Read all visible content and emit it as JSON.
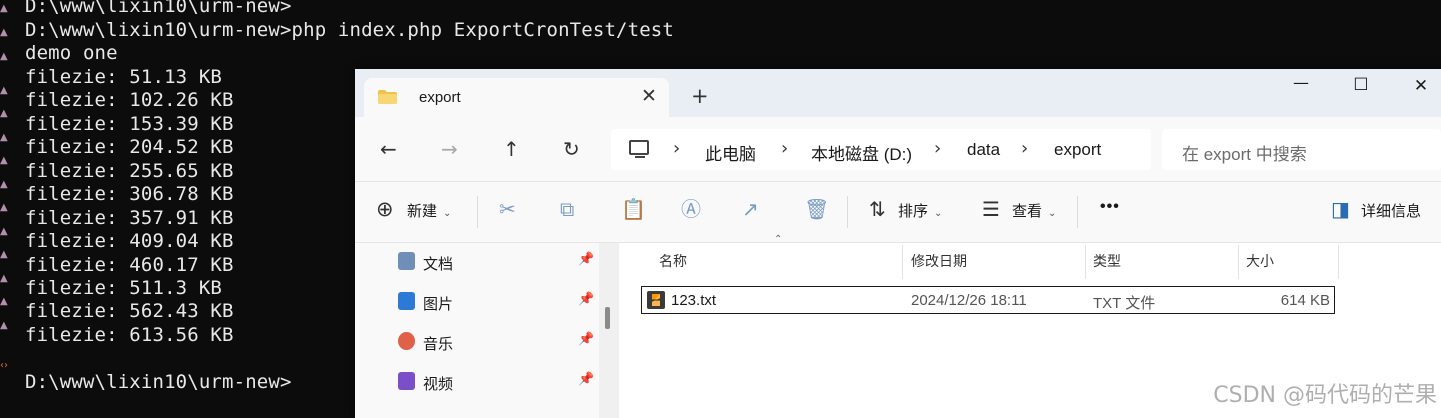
{
  "terminal": {
    "lines": [
      "D:\\www\\lixin10\\urm-new>",
      "D:\\www\\lixin10\\urm-new>php index.php ExportCronTest/test",
      "demo one",
      "filezie: 51.13 KB",
      "filezie: 102.26 KB",
      "filezie: 153.39 KB",
      "filezie: 204.52 KB",
      "filezie: 255.65 KB",
      "filezie: 306.78 KB",
      "filezie: 357.91 KB",
      "filezie: 409.04 KB",
      "filezie: 460.17 KB",
      "filezie: 511.3 KB",
      "filezie: 562.43 KB",
      "filezie: 613.56 KB",
      "",
      "D:\\www\\lixin10\\urm-new>"
    ]
  },
  "explorer": {
    "tab": {
      "label": "export",
      "icon": "folder-icon"
    },
    "window_controls": {
      "minimize": "—",
      "maximize": "☐",
      "close": "✕"
    },
    "nav": {
      "back": "←",
      "forward": "→",
      "up": "↑",
      "refresh": "↻"
    },
    "breadcrumb": [
      "此电脑",
      "本地磁盘 (D:)",
      "data",
      "export"
    ],
    "search_placeholder": "在 export 中搜索",
    "toolbar": {
      "new_label": "新建",
      "sort_label": "排序",
      "view_label": "查看",
      "more_label": "•••",
      "details_label": "详细信息"
    },
    "sidebar": [
      {
        "label": "文档",
        "icon": "documents-icon",
        "color": "#6f8fb8"
      },
      {
        "label": "图片",
        "icon": "pictures-icon",
        "color": "#2b7bd6"
      },
      {
        "label": "音乐",
        "icon": "music-icon",
        "color": "#e0604a"
      },
      {
        "label": "视频",
        "icon": "videos-icon",
        "color": "#7a4fc7"
      }
    ],
    "columns": [
      "名称",
      "修改日期",
      "类型",
      "大小"
    ],
    "files": [
      {
        "name": "123.txt",
        "modified": "2024/12/26 18:11",
        "type": "TXT 文件",
        "size": "614 KB"
      }
    ]
  },
  "watermark": "CSDN @码代码的芒果"
}
